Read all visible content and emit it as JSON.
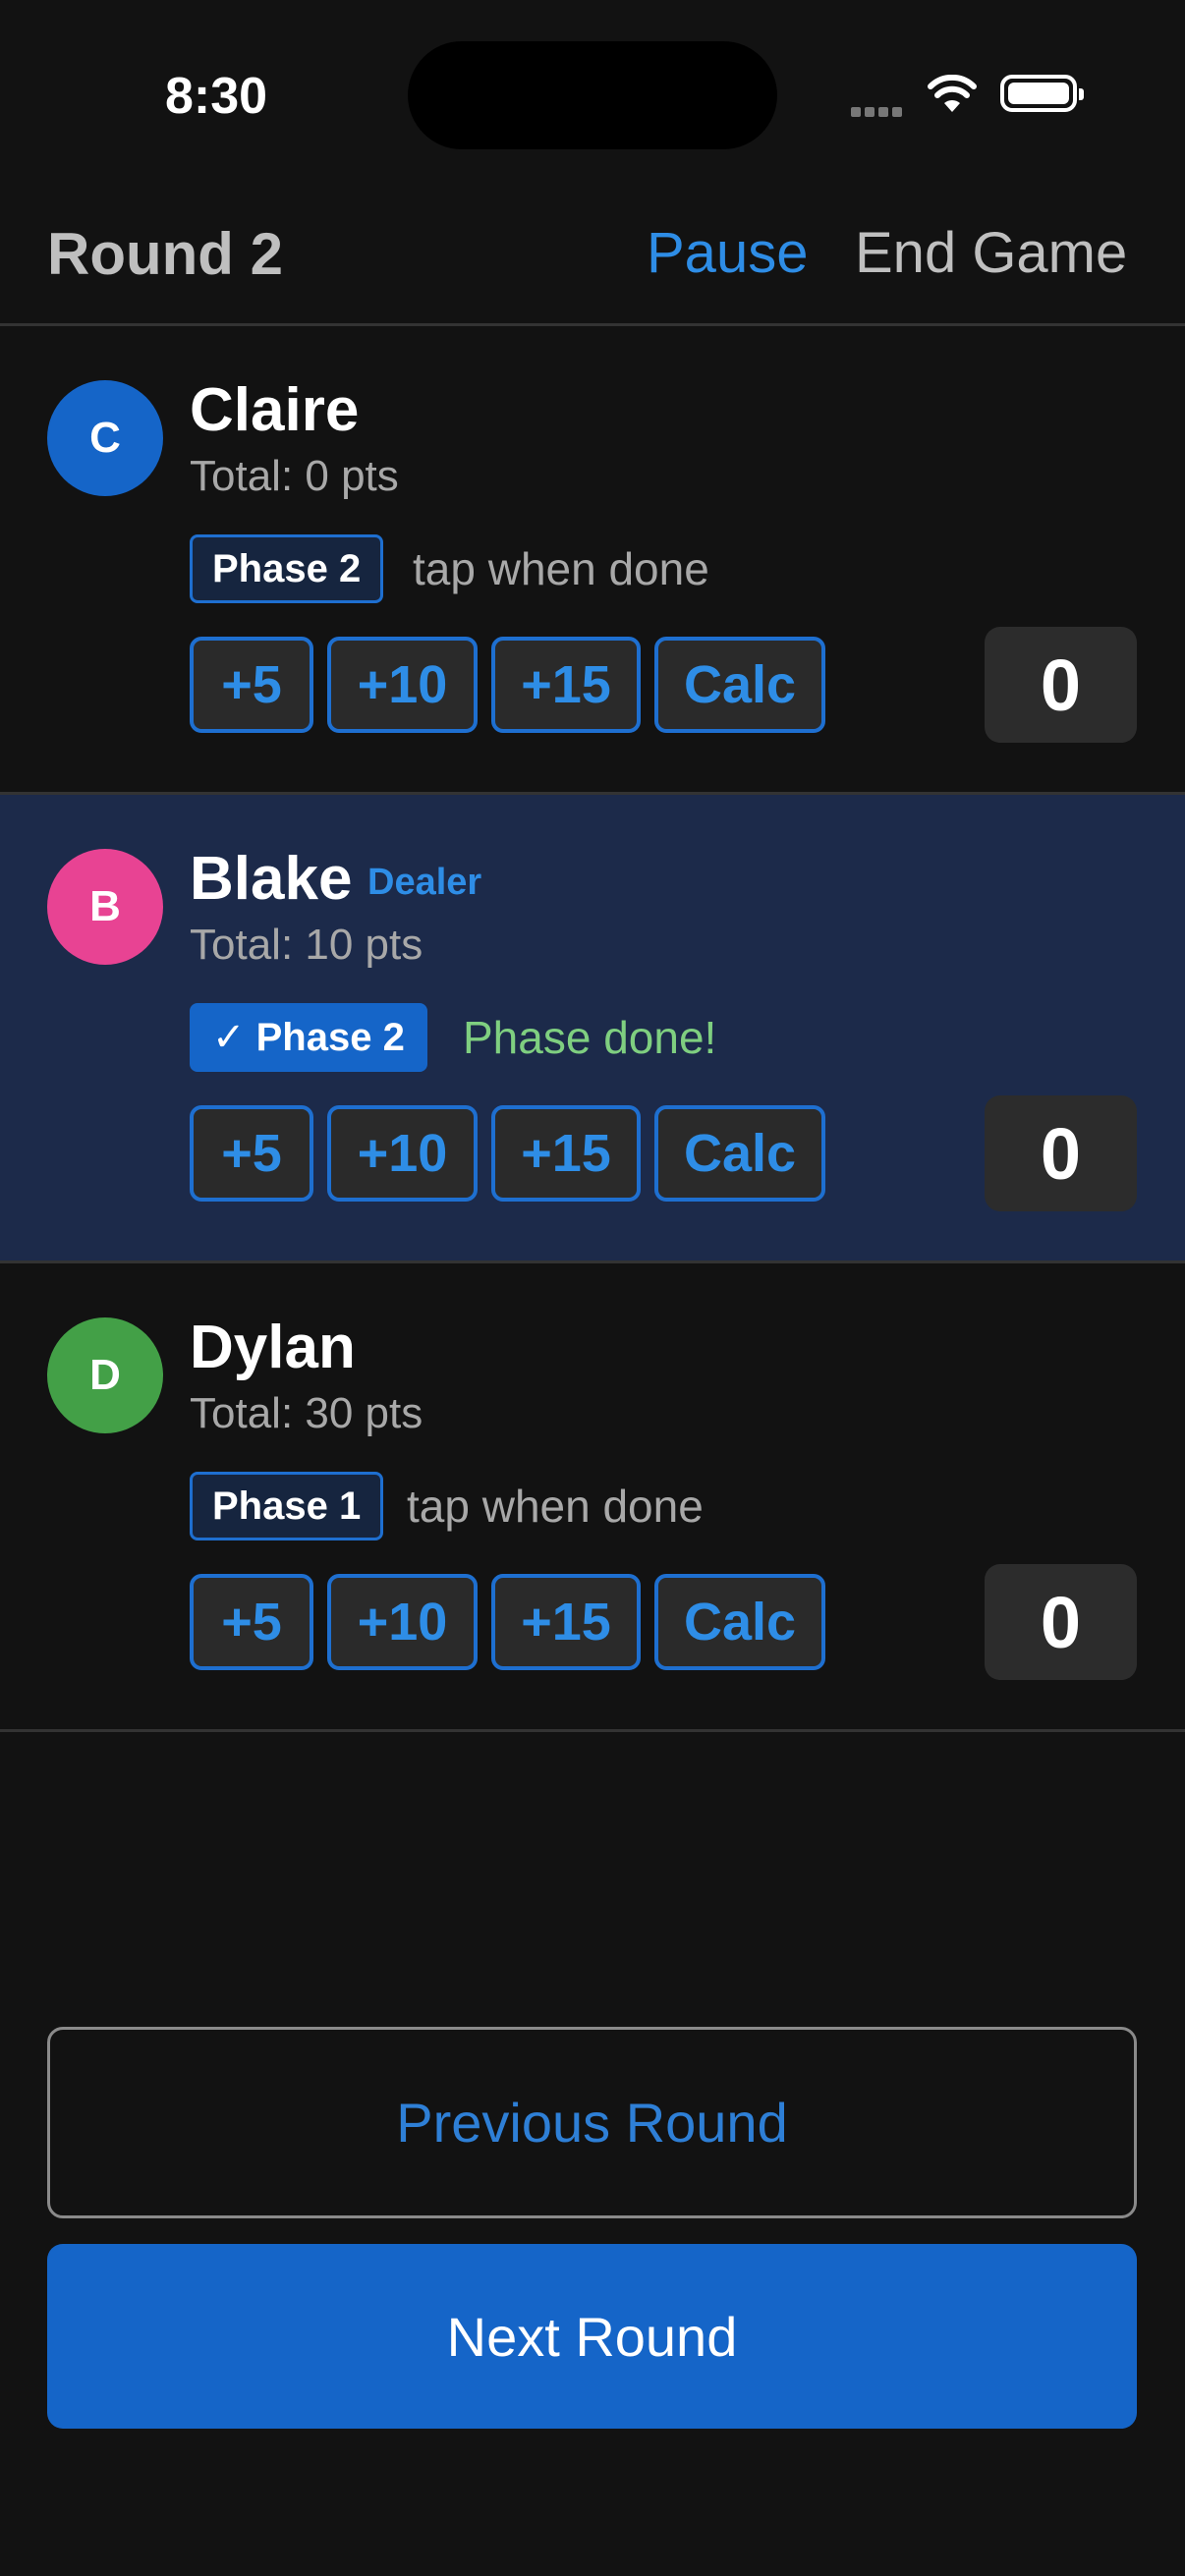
{
  "status_bar": {
    "time": "8:30"
  },
  "header": {
    "title": "Round 2",
    "pause_label": "Pause",
    "end_label": "End Game"
  },
  "players": [
    {
      "initial": "C",
      "name": "Claire",
      "total": "Total: 0 pts",
      "phase": "Phase 2",
      "phase_hint": "tap when done",
      "dealer": "",
      "score": "0",
      "avatar_color": "#1565c8"
    },
    {
      "initial": "B",
      "name": "Blake",
      "total": "Total: 10 pts",
      "phase": "✓ Phase 2",
      "phase_hint": "Phase done!",
      "dealer": "Dealer",
      "score": "0",
      "avatar_color": "#e84393"
    },
    {
      "initial": "D",
      "name": "Dylan",
      "total": "Total: 30 pts",
      "phase": "Phase 1",
      "phase_hint": "tap when done",
      "dealer": "",
      "score": "0",
      "avatar_color": "#43a047"
    }
  ],
  "quick_buttons": [
    "+5",
    "+10",
    "+15",
    "Calc"
  ],
  "footer": {
    "previous_label": "Previous Round",
    "next_label": "Next Round"
  },
  "colors": {
    "accent": "#1565c8",
    "link": "#2e8de6",
    "done": "#7fcf80",
    "background": "#121212",
    "dealer_row": "#1c2a4a"
  }
}
